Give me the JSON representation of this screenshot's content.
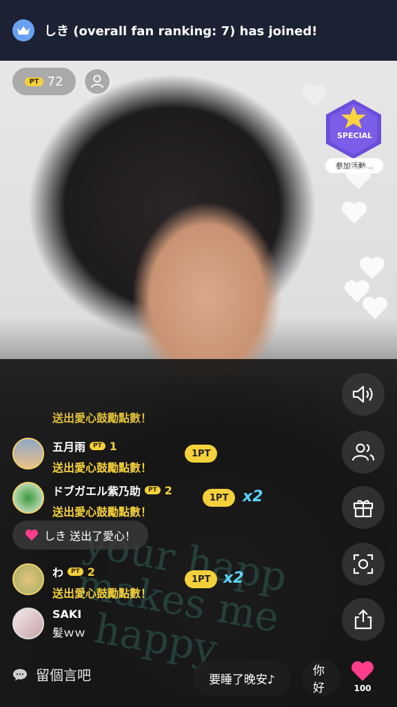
{
  "banner": {
    "icon": "crown-icon",
    "text": "しき (overall fan ranking: 7) has joined!"
  },
  "header": {
    "pt_badge": "PT",
    "pt_value": "72",
    "profile_icon": "person-icon"
  },
  "special_badge": {
    "label": "SPECIAL",
    "event_label": "参加活動..."
  },
  "chat": {
    "partial_msg": "送出愛心鼓勵點數！",
    "rows": [
      {
        "name": "五月雨",
        "pt_badge": "PT",
        "level": "1",
        "message": "送出愛心鼓勵點數！",
        "pt_tag": "1PT",
        "multiplier": ""
      },
      {
        "name": "ドブガエル紫乃助",
        "pt_badge": "PT",
        "level": "2",
        "message": "送出愛心鼓勵點數！",
        "pt_tag": "1PT",
        "multiplier": "x2"
      },
      {
        "name": "わ",
        "pt_badge": "PT",
        "level": "2",
        "message": "送出愛心鼓勵點數！",
        "pt_tag": "1PT",
        "multiplier": "x2"
      },
      {
        "name": "SAKI",
        "message": "髪ｗｗ"
      }
    ],
    "heart_notice": "しき 送出了愛心！"
  },
  "side_buttons": [
    "speaker-icon",
    "users-icon",
    "gift-icon",
    "camera-flip-icon",
    "share-icon"
  ],
  "bottom": {
    "comment_placeholder": "留個言吧",
    "chip1": "要睡了晚安♪",
    "chip2": "你好",
    "like_count": "100"
  },
  "colors": {
    "banner_bg": "#1c2233",
    "gold": "#f4d13b",
    "multiplier": "#5ad4ff",
    "heart": "#ff3d8b"
  }
}
